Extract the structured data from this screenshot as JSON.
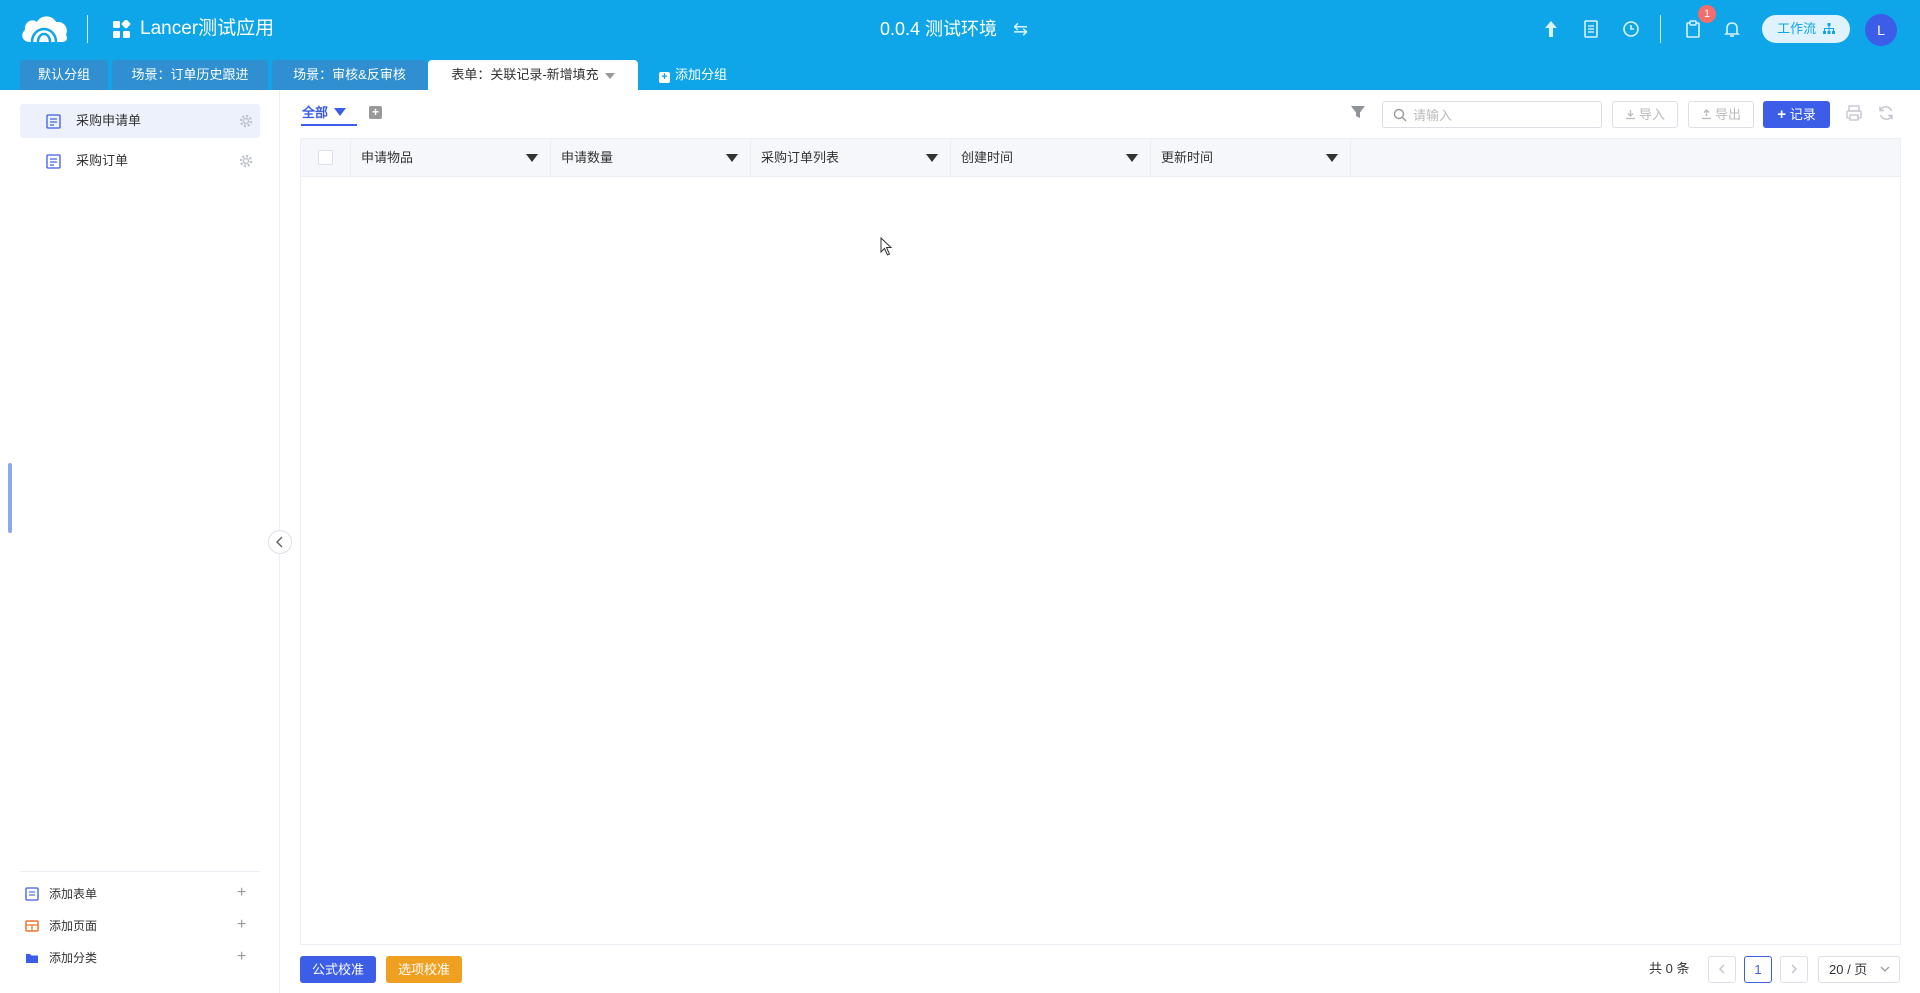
{
  "header": {
    "app_title": "Lancer测试应用",
    "environment": "0.0.4 测试环境",
    "env_switch_glyph": "⇆",
    "notification_badge": "1",
    "workflow_label": "工作流",
    "avatar_initial": "L",
    "bg_color": "#0ea5e9"
  },
  "tabs": [
    {
      "label": "默认分组"
    },
    {
      "label": "场景：订单历史跟进"
    },
    {
      "label": "场景：审核&反审核"
    },
    {
      "label": "表单：关联记录-新增填充"
    }
  ],
  "add_group_label": "添加分组",
  "sidebar": {
    "items": [
      {
        "label": "采购申请单"
      },
      {
        "label": "采购订单"
      }
    ],
    "footer": [
      {
        "label": "添加表单"
      },
      {
        "label": "添加页面"
      },
      {
        "label": "添加分类"
      }
    ]
  },
  "toolbar": {
    "view_label": "全部",
    "search_placeholder": "请输入",
    "import_label": "导入",
    "export_label": "导出",
    "add_record_label": "记录",
    "primary_color": "#3b5de7"
  },
  "table": {
    "columns": [
      "申请物品",
      "申请数量",
      "采购订单列表",
      "创建时间",
      "更新时间"
    ]
  },
  "footer": {
    "formula_check": "公式校准",
    "option_check": "选项校准",
    "total": "共 0 条",
    "current_page": "1",
    "page_size": "20 / 页"
  }
}
